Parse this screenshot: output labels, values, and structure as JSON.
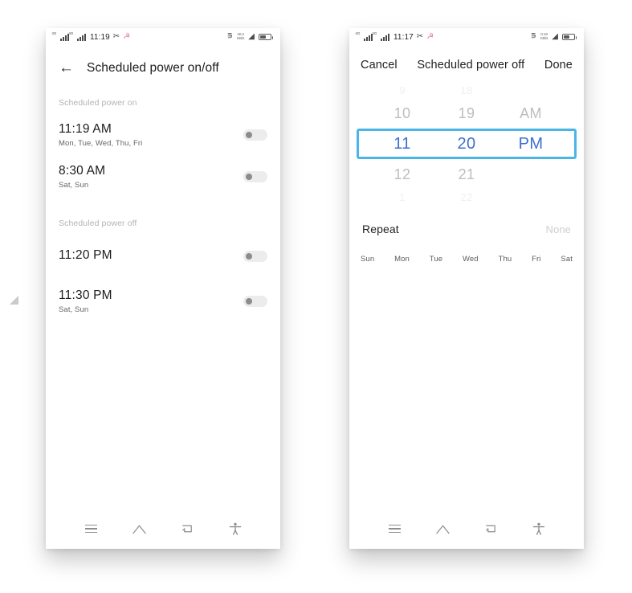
{
  "left_phone": {
    "status_bar": {
      "time": "11:19",
      "signal_label_1": "4G",
      "signal_label_2": "4G",
      "bluetooth_icon": "bluetooth-off-icon",
      "alarm_icon": "pink-app-icon",
      "mute_icon": "vibrate-off-icon",
      "net_speed_value": "40.2",
      "net_speed_unit": "KB/s",
      "wifi_icon": "wifi-icon",
      "battery_icon": "battery-icon"
    },
    "header": {
      "back_icon": "back-arrow-icon",
      "title": "Scheduled power on/off"
    },
    "sections": [
      {
        "label": "Scheduled power on",
        "items": [
          {
            "time": "11:19 AM",
            "days": "Mon, Tue, Wed, Thu, Fri",
            "enabled": "off"
          },
          {
            "time": "8:30 AM",
            "days": "Sat, Sun",
            "enabled": "off"
          }
        ]
      },
      {
        "label": "Scheduled power off",
        "items": [
          {
            "time": "11:20 PM",
            "days": "",
            "enabled": "off"
          },
          {
            "time": "11:30 PM",
            "days": "Sat, Sun",
            "enabled": "off"
          }
        ]
      }
    ],
    "nav_bar": {
      "recents": "menu-icon",
      "home": "home-icon",
      "back": "back-nav-icon",
      "accessibility": "accessibility-icon"
    }
  },
  "right_phone": {
    "status_bar": {
      "time": "11:17",
      "signal_label_1": "4G",
      "signal_label_2": "4G",
      "net_speed_value": "0.10",
      "net_speed_unit": "KB/s"
    },
    "picker_header": {
      "cancel_label": "Cancel",
      "title": "Scheduled power off",
      "done_label": "Done"
    },
    "time_picker": {
      "hour_column": {
        "above_faint": "9",
        "above": "10",
        "selected": "11",
        "below": "12",
        "below_faint": "1"
      },
      "minute_column": {
        "above_faint": "18",
        "above": "19",
        "selected": "20",
        "below": "21",
        "below_faint": "22"
      },
      "meridiem_column": {
        "above_faint": "",
        "above": "AM",
        "selected": "PM",
        "below": "",
        "below_faint": ""
      },
      "selection_border_color": "#4ab6e8",
      "selection_text_color": "#3d6fd0"
    },
    "repeat": {
      "label": "Repeat",
      "value": "None",
      "weekdays": [
        "Sun",
        "Mon",
        "Tue",
        "Wed",
        "Thu",
        "Fri",
        "Sat"
      ]
    },
    "nav_bar": {
      "recents": "menu-icon",
      "home": "home-icon",
      "back": "back-nav-icon",
      "accessibility": "accessibility-icon"
    }
  }
}
